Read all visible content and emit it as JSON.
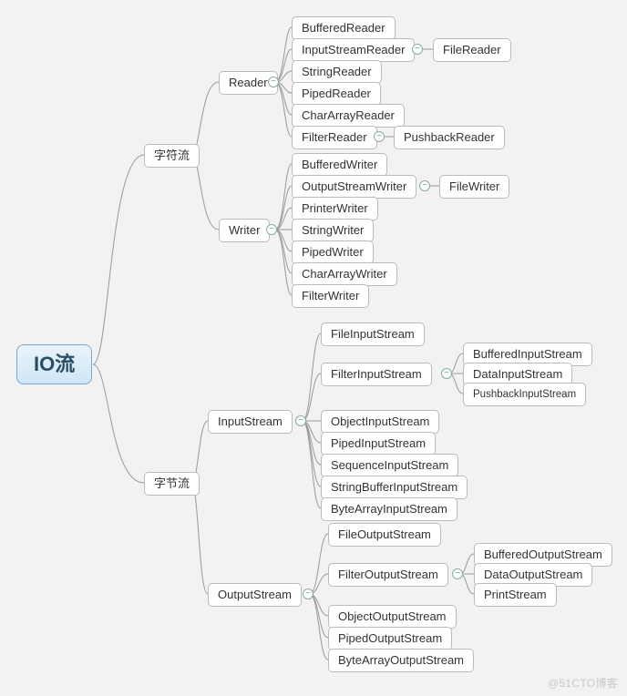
{
  "root": "IO流",
  "level1": {
    "charStream": "字符流",
    "byteStream": "字节流"
  },
  "reader": {
    "label": "Reader",
    "children": [
      "BufferedReader",
      "InputStreamReader",
      "StringReader",
      "PipedReader",
      "CharArrayReader",
      "FilterReader"
    ],
    "sub": {
      "inputStreamReader": "FileReader",
      "filterReader": "PushbackReader"
    }
  },
  "writer": {
    "label": "Writer",
    "children": [
      "BufferedWriter",
      "OutputStreamWriter",
      "PrinterWriter",
      "StringWriter",
      "PipedWriter",
      "CharArrayWriter",
      "FilterWriter"
    ],
    "sub": {
      "outputStreamWriter": "FileWriter"
    }
  },
  "inputStream": {
    "label": "InputStream",
    "children": [
      "FileInputStream",
      "FilterInputStream",
      "ObjectInputStream",
      "PipedInputStream",
      "SequenceInputStream",
      "StringBufferInputStream",
      "ByteArrayInputStream"
    ],
    "sub": {
      "filterInputStream": [
        "BufferedInputStream",
        "DataInputStream",
        "PushbackInputStream"
      ]
    }
  },
  "outputStream": {
    "label": "OutputStream",
    "children": [
      "FileOutputStream",
      "FilterOutputStream",
      "ObjectOutputStream",
      "PipedOutputStream",
      "ByteArrayOutputStream"
    ],
    "sub": {
      "filterOutputStream": [
        "BufferedOutputStream",
        "DataOutputStream",
        "PrintStream"
      ]
    }
  },
  "watermark": "@51CTO博客"
}
